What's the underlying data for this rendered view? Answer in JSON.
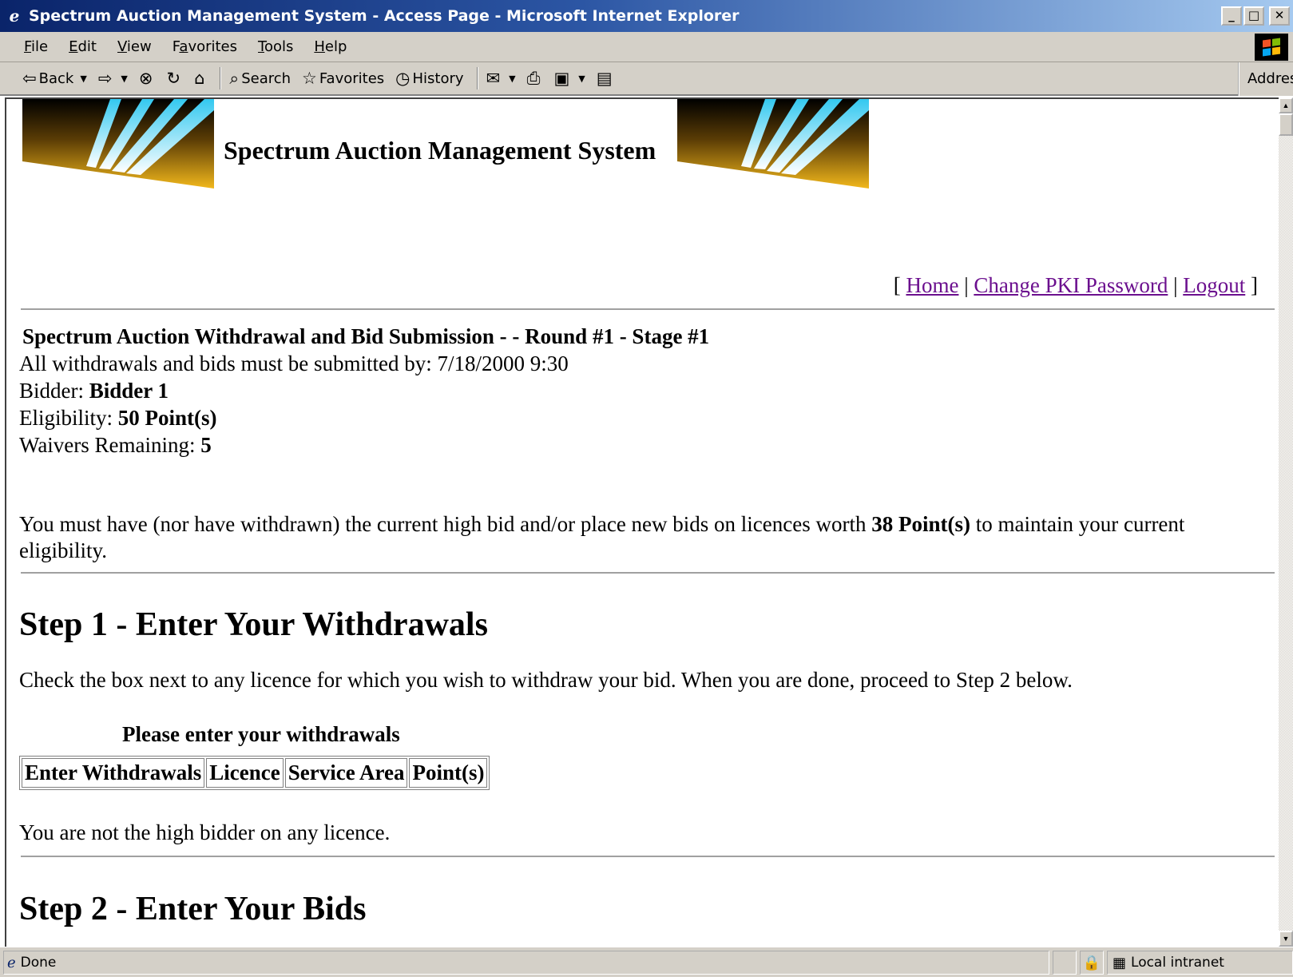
{
  "window": {
    "title": "Spectrum Auction Management System - Access Page - Microsoft Internet Explorer",
    "controls": {
      "minimize": "_",
      "maximize": "□",
      "close": "✕"
    }
  },
  "menu": [
    {
      "label": "File",
      "accel": "F",
      "rest": "ile"
    },
    {
      "label": "Edit",
      "accel": "E",
      "rest": "dit"
    },
    {
      "label": "View",
      "accel": "V",
      "rest": "iew"
    },
    {
      "label": "Favorites",
      "accel": "a",
      "pre": "F",
      "rest": "vorites"
    },
    {
      "label": "Tools",
      "accel": "T",
      "rest": "ools"
    },
    {
      "label": "Help",
      "accel": "H",
      "rest": "elp"
    }
  ],
  "toolbar": {
    "back": "Back",
    "search": "Search",
    "favorites": "Favorites",
    "history": "History",
    "address": "Address"
  },
  "page": {
    "banner_title": "Spectrum Auction Management System",
    "nav": {
      "open": "[",
      "home": "Home",
      "sep": "|",
      "change_pki": "Change PKI Password",
      "logout": "Logout",
      "close": "]"
    },
    "heading": "Spectrum Auction Withdrawal and Bid Submission - - Round #1 - Stage #1",
    "deadline_label": "All withdrawals and bids must be submitted by:",
    "deadline_value": "7/18/2000 9:30",
    "bidder_label": "Bidder:",
    "bidder_value": "Bidder 1",
    "eligibility_label": "Eligibility:",
    "eligibility_value": "50 Point(s)",
    "waivers_label": "Waivers Remaining:",
    "waivers_value": "5",
    "notice_pre": "You must have (nor have withdrawn) the current high bid and/or place new bids on licences worth",
    "notice_points": "38 Point(s)",
    "notice_post": "to maintain your current eligibility.",
    "step1_title": "Step 1 - Enter Your Withdrawals",
    "step1_text": "Check the box next to any licence for which you wish to withdraw your bid. When you are done, proceed to Step 2 below.",
    "table_caption": "Please enter your withdrawals",
    "table_headers": [
      "Enter Withdrawals",
      "Licence",
      "Service Area",
      "Point(s)"
    ],
    "no_high_bid": "You are not the high bidder on any licence.",
    "step2_title": "Step 2 - Enter Your Bids"
  },
  "status": {
    "text": "Done",
    "zone": "Local intranet"
  },
  "colors": {
    "title_bar": "#0a246a",
    "chrome": "#d4d0c8",
    "visited_link": "#6b0f8e",
    "logo_gold": "#f2b81c",
    "logo_cyan": "#33c8f0"
  }
}
